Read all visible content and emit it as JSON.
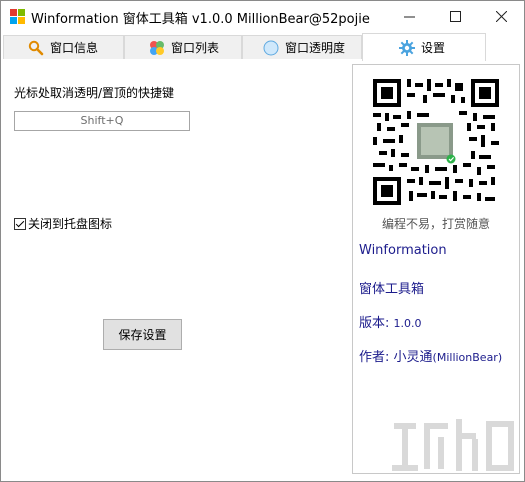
{
  "window": {
    "title": "Winformation 窗体工具箱 v1.0.0  MillionBear@52pojie"
  },
  "tabs": [
    {
      "label": "窗口信息",
      "icon": "search-icon"
    },
    {
      "label": "窗口列表",
      "icon": "color-palette-icon"
    },
    {
      "label": "窗口透明度",
      "icon": "circle-icon"
    },
    {
      "label": "设置",
      "icon": "gear-icon",
      "active": true
    }
  ],
  "settings": {
    "hotkey_label": "光标处取消透明/置顶的快捷键",
    "hotkey_value": "Shift+Q",
    "tray_checkbox_label": "关闭到托盘图标",
    "tray_checked": true,
    "save_button": "保存设置"
  },
  "side": {
    "qr_caption": "编程不易，打赏随意",
    "app_name": "Winformation",
    "app_cn_name": "窗体工具箱",
    "version_label": "版本:",
    "version_value": "1.0.0",
    "author_label": "作者:",
    "author_name": "小灵通",
    "author_handle": "(MillionBear)"
  },
  "colors": {
    "info_text": "#1c1c8c",
    "tab_bg": "#f0f0f0",
    "button_bg": "#e1e1e1"
  }
}
